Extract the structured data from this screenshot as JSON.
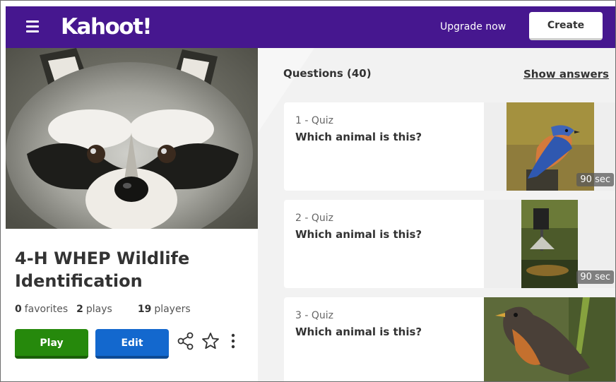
{
  "header": {
    "logo_text": "Kahoot!",
    "upgrade_label": "Upgrade now",
    "create_label": "Create",
    "menu_icon": "hamburger-menu-icon"
  },
  "kahoot": {
    "title": "4-H WHEP Wildlife Identification",
    "cover_image": "raccoon-photo",
    "stats": {
      "favorites_count": "0",
      "favorites_label": "favorites",
      "plays_count": "2",
      "plays_label": "plays",
      "players_count": "19",
      "players_label": "players"
    },
    "actions": {
      "play_label": "Play",
      "edit_label": "Edit",
      "share_icon": "share-icon",
      "favorite_icon": "star-icon",
      "more_icon": "more-vertical-icon"
    }
  },
  "questions": {
    "heading": "Questions (40)",
    "show_answers_label": "Show answers",
    "items": [
      {
        "type_label": "1 - Quiz",
        "text": "Which animal is this?",
        "time": "90 sec",
        "image": "bluebird-photo"
      },
      {
        "type_label": "2 - Quiz",
        "text": "Which animal is this?",
        "time": "90 sec",
        "image": "feeder-photo"
      },
      {
        "type_label": "3 - Quiz",
        "text": "Which animal is this?",
        "time": "",
        "image": "robin-photo"
      }
    ]
  },
  "colors": {
    "brand_purple": "#46178f",
    "play_green": "#26890c",
    "edit_blue": "#1368ce"
  }
}
